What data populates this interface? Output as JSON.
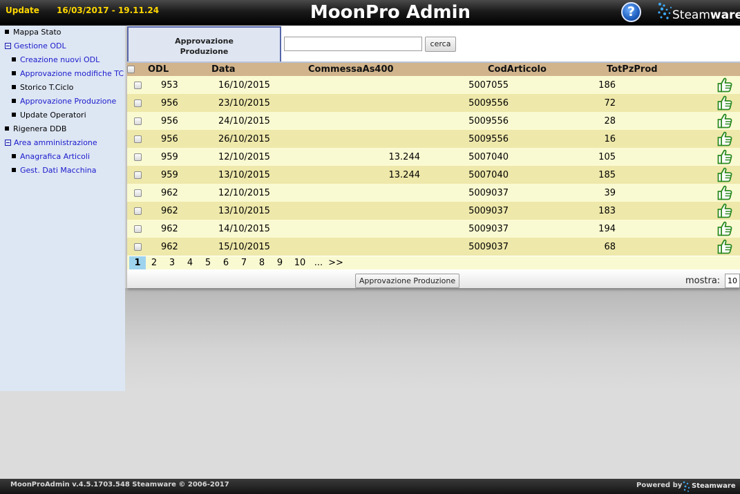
{
  "header": {
    "update_label": "Update",
    "datetime": "16/03/2017 - 19.11.24",
    "title": "MoonPro Admin",
    "help_symbol": "?",
    "logo_text": "Steamware",
    "logo_text_start": "Steam",
    "logo_text_end": "ware"
  },
  "sidebar": {
    "items": [
      {
        "label": "Mappa Stato",
        "level": 0,
        "marker": "bullet",
        "link": false
      },
      {
        "label": "Gestione ODL",
        "level": 0,
        "marker": "minus",
        "link": true
      },
      {
        "label": "Creazione nuovi ODL",
        "level": 1,
        "marker": "bullet",
        "link": true
      },
      {
        "label": "Approvazione modifiche TC",
        "level": 1,
        "marker": "bullet",
        "link": true
      },
      {
        "label": "Storico T.Ciclo",
        "level": 1,
        "marker": "bullet",
        "link": false
      },
      {
        "label": "Approvazione Produzione",
        "level": 1,
        "marker": "bullet",
        "link": true
      },
      {
        "label": "Update Operatori",
        "level": 1,
        "marker": "bullet",
        "link": false
      },
      {
        "label": "Rigenera DDB",
        "level": 0,
        "marker": "bullet",
        "link": false
      },
      {
        "label": "Area amministrazione",
        "level": 0,
        "marker": "minus",
        "link": true
      },
      {
        "label": "Anagrafica Articoli",
        "level": 1,
        "marker": "bullet",
        "link": true
      },
      {
        "label": "Gest. Dati Macchina",
        "level": 1,
        "marker": "bullet",
        "link": true
      }
    ]
  },
  "main": {
    "tab_line1": "Approvazione",
    "tab_line2": "Produzione",
    "search_value": "",
    "search_button": "cerca",
    "columns": [
      "ODL",
      "Data",
      "CommessaAs400",
      "CodArticolo",
      "TotPzProd"
    ],
    "rows": [
      {
        "odl": "953",
        "data": "16/10/2015",
        "commessa": "",
        "cod": "5007055",
        "tot": "186"
      },
      {
        "odl": "956",
        "data": "23/10/2015",
        "commessa": "",
        "cod": "5009556",
        "tot": "72"
      },
      {
        "odl": "956",
        "data": "24/10/2015",
        "commessa": "",
        "cod": "5009556",
        "tot": "28"
      },
      {
        "odl": "956",
        "data": "26/10/2015",
        "commessa": "",
        "cod": "5009556",
        "tot": "16"
      },
      {
        "odl": "959",
        "data": "12/10/2015",
        "commessa": "13.244",
        "cod": "5007040",
        "tot": "105"
      },
      {
        "odl": "959",
        "data": "13/10/2015",
        "commessa": "13.244",
        "cod": "5007040",
        "tot": "185"
      },
      {
        "odl": "962",
        "data": "12/10/2015",
        "commessa": "",
        "cod": "5009037",
        "tot": "39"
      },
      {
        "odl": "962",
        "data": "13/10/2015",
        "commessa": "",
        "cod": "5009037",
        "tot": "183"
      },
      {
        "odl": "962",
        "data": "14/10/2015",
        "commessa": "",
        "cod": "5009037",
        "tot": "194"
      },
      {
        "odl": "962",
        "data": "15/10/2015",
        "commessa": "",
        "cod": "5009037",
        "tot": "68"
      }
    ],
    "pager": [
      "1",
      "2",
      "3",
      "4",
      "5",
      "6",
      "7",
      "8",
      "9",
      "10",
      "...",
      ">>"
    ],
    "current_page": "1",
    "approve_button": "Approvazione Produzione",
    "mostra_label": "mostra:",
    "mostra_value": "10"
  },
  "footer": {
    "version": "MoonProAdmin v.4.5.1703.548 Steamware © 2006-2017",
    "powered_by": "Powered by",
    "logo_text": "Steamware"
  },
  "colors": {
    "header_yellow": "#ffd700",
    "link_blue": "#1a1acc",
    "row_odd": "#fafad2",
    "row_even": "#eee8aa",
    "table_header": "#d2b48c",
    "pager_active": "#9ed3ee",
    "thumb_green": "#2e8b22"
  },
  "icons": {
    "row_action": "thumbs-up-icon",
    "help": "help-icon",
    "logo": "steamware-logo"
  }
}
